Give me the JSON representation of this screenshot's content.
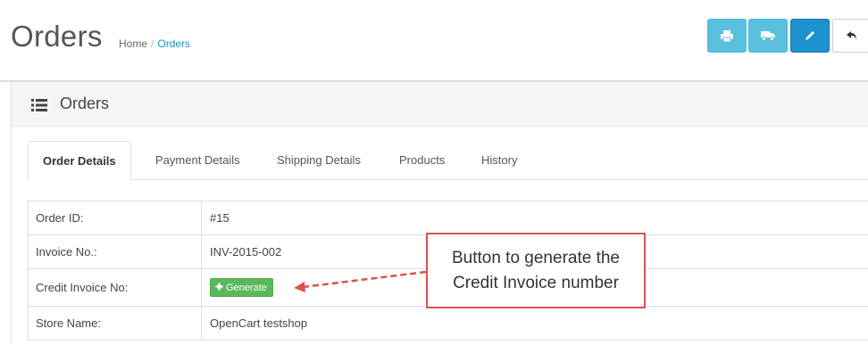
{
  "header": {
    "title": "Orders",
    "breadcrumb": {
      "home": "Home",
      "separator": "/",
      "current": "Orders"
    },
    "buttons": [
      {
        "name": "print-invoice-button",
        "icon": "print-icon",
        "color": "#5bc0de"
      },
      {
        "name": "print-shipping-button",
        "icon": "truck-icon",
        "color": "#5bc0de"
      },
      {
        "name": "edit-button",
        "icon": "pencil-icon",
        "color": "#1e91cf"
      },
      {
        "name": "back-button",
        "icon": "reply-icon",
        "color": "#ffffff"
      }
    ]
  },
  "panel": {
    "title": "Orders",
    "icon": "list-icon"
  },
  "tabs": [
    {
      "label": "Order Details",
      "active": true
    },
    {
      "label": "Payment Details",
      "active": false
    },
    {
      "label": "Shipping Details",
      "active": false
    },
    {
      "label": "Products",
      "active": false
    },
    {
      "label": "History",
      "active": false
    }
  ],
  "details": {
    "order_id": {
      "label": "Order ID:",
      "value": "#15"
    },
    "invoice_no": {
      "label": "Invoice No.:",
      "value": "INV-2015-002"
    },
    "credit_invoice": {
      "label": "Credit Invoice No:",
      "button_label": "Generate",
      "button_icon": "gear-icon",
      "button_color": "#5cb85c"
    },
    "store_name": {
      "label": "Store Name:",
      "value": "OpenCart testshop"
    }
  },
  "annotation": {
    "line1": "Button to generate the",
    "line2": "Credit Invoice number",
    "border_color": "#d9534f"
  }
}
